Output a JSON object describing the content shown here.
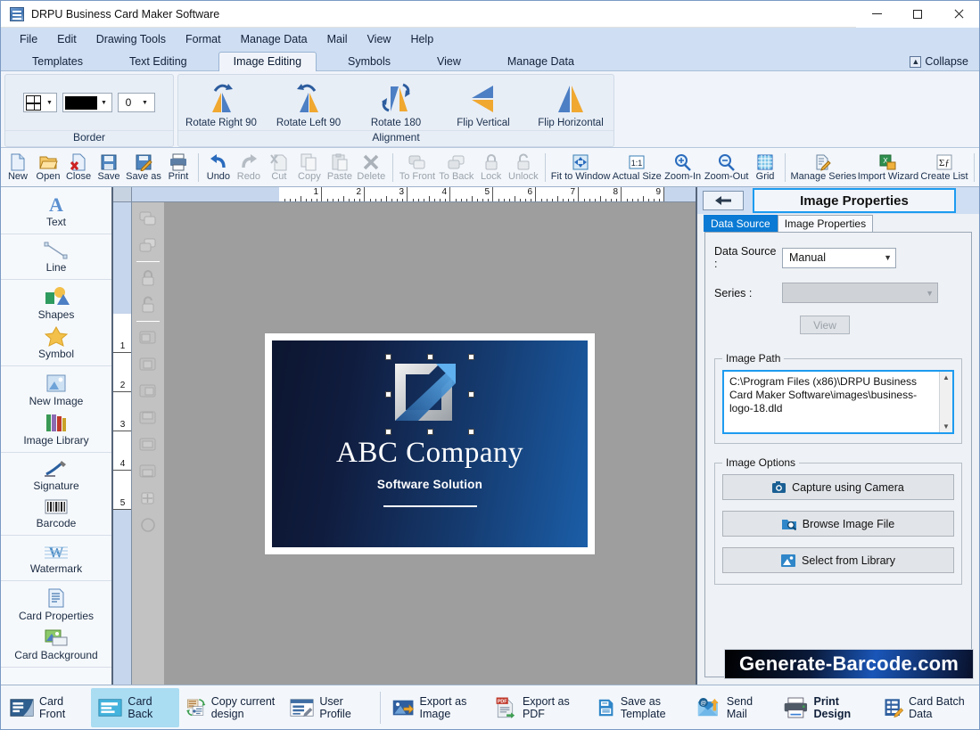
{
  "window": {
    "title": "DRPU Business Card Maker Software",
    "icon": "app-icon",
    "minimize": "minimize",
    "maximize": "maximize",
    "close": "close"
  },
  "menubar": {
    "items": [
      "File",
      "Edit",
      "Drawing Tools",
      "Format",
      "Manage Data",
      "Mail",
      "View",
      "Help"
    ]
  },
  "ribbon_tabs": {
    "items": [
      "Templates",
      "Text Editing",
      "Image Editing",
      "Symbols",
      "View",
      "Manage Data"
    ],
    "active": "Image Editing",
    "collapse_label": "Collapse"
  },
  "ribbon": {
    "groups": [
      {
        "label": "Border",
        "border_style_value": "",
        "border_color": "#000000",
        "border_width_value": "0"
      },
      {
        "label": "Alignment",
        "tools": [
          {
            "label": "Rotate Right 90",
            "icon": "rotate-right-90-icon"
          },
          {
            "label": "Rotate Left 90",
            "icon": "rotate-left-90-icon"
          },
          {
            "label": "Rotate 180",
            "icon": "rotate-180-icon"
          },
          {
            "label": "Flip Vertical",
            "icon": "flip-vertical-icon"
          },
          {
            "label": "Flip Horizontal",
            "icon": "flip-horizontal-icon"
          }
        ]
      }
    ]
  },
  "toolbar": {
    "groups": [
      [
        {
          "label": "New",
          "icon": "new-file-icon",
          "disabled": false
        },
        {
          "label": "Open",
          "icon": "open-folder-icon",
          "disabled": false
        },
        {
          "label": "Close",
          "icon": "close-file-icon",
          "disabled": false
        },
        {
          "label": "Save",
          "icon": "save-icon",
          "disabled": false
        },
        {
          "label": "Save as",
          "icon": "save-as-icon",
          "disabled": false
        },
        {
          "label": "Print",
          "icon": "print-icon",
          "disabled": false
        }
      ],
      [
        {
          "label": "Undo",
          "icon": "undo-icon",
          "disabled": false
        },
        {
          "label": "Redo",
          "icon": "redo-icon",
          "disabled": true
        },
        {
          "label": "Cut",
          "icon": "cut-icon",
          "disabled": true
        },
        {
          "label": "Copy",
          "icon": "copy-icon",
          "disabled": true
        },
        {
          "label": "Paste",
          "icon": "paste-icon",
          "disabled": true
        },
        {
          "label": "Delete",
          "icon": "delete-icon",
          "disabled": true
        }
      ],
      [
        {
          "label": "To Front",
          "icon": "to-front-icon",
          "disabled": true
        },
        {
          "label": "To Back",
          "icon": "to-back-icon",
          "disabled": true
        },
        {
          "label": "Lock",
          "icon": "lock-icon",
          "disabled": true
        },
        {
          "label": "Unlock",
          "icon": "unlock-icon",
          "disabled": true
        }
      ],
      [
        {
          "label": "Fit to Window",
          "icon": "fit-to-window-icon",
          "disabled": false
        },
        {
          "label": "Actual Size",
          "icon": "actual-size-icon",
          "disabled": false
        },
        {
          "label": "Zoom-In",
          "icon": "zoom-in-icon",
          "disabled": false
        },
        {
          "label": "Zoom-Out",
          "icon": "zoom-out-icon",
          "disabled": false
        },
        {
          "label": "Grid",
          "icon": "grid-icon",
          "disabled": false
        }
      ],
      [
        {
          "label": "Manage Series",
          "icon": "manage-series-icon",
          "disabled": false
        },
        {
          "label": "Import Wizard",
          "icon": "import-wizard-icon",
          "disabled": false
        },
        {
          "label": "Create List",
          "icon": "create-list-icon",
          "disabled": false
        }
      ]
    ]
  },
  "sidebar": {
    "sections": [
      {
        "items": [
          {
            "label": "Text",
            "icon": "text-a-icon"
          }
        ]
      },
      {
        "items": [
          {
            "label": "Line",
            "icon": "line-icon"
          }
        ]
      },
      {
        "items": [
          {
            "label": "Shapes",
            "icon": "shapes-icon"
          },
          {
            "label": "Symbol",
            "icon": "symbol-star-icon"
          }
        ]
      },
      {
        "items": [
          {
            "label": "New Image",
            "icon": "new-image-icon"
          },
          {
            "label": "Image Library",
            "icon": "image-library-icon"
          }
        ]
      },
      {
        "items": [
          {
            "label": "Signature",
            "icon": "signature-pen-icon"
          },
          {
            "label": "Barcode",
            "icon": "barcode-icon"
          }
        ]
      },
      {
        "items": [
          {
            "label": "Watermark",
            "icon": "watermark-w-icon"
          }
        ]
      },
      {
        "items": [
          {
            "label": "Card Properties",
            "icon": "card-properties-icon"
          },
          {
            "label": "Card Background",
            "icon": "card-background-icon"
          }
        ]
      }
    ]
  },
  "rulers": {
    "horizontal_ticks": [
      "1",
      "2",
      "3",
      "4",
      "5",
      "6",
      "7",
      "8",
      "9"
    ],
    "vertical_ticks": [
      "1",
      "2",
      "3",
      "4",
      "5"
    ]
  },
  "vertical_toolbar": {
    "items": [
      {
        "icon": "bring-to-front-icon"
      },
      {
        "icon": "send-to-back-icon"
      },
      {
        "icon": "lock-icon"
      },
      {
        "icon": "unlock-icon"
      },
      {
        "icon": "align-left-icon"
      },
      {
        "icon": "align-center-icon"
      },
      {
        "icon": "align-right-icon"
      },
      {
        "icon": "align-top-icon"
      },
      {
        "icon": "align-middle-icon"
      },
      {
        "icon": "align-bottom-icon"
      },
      {
        "icon": "distribute-icon"
      },
      {
        "icon": "rotate-shape-icon"
      }
    ]
  },
  "card": {
    "company_name": "ABC Company",
    "tagline": "Software Solution",
    "selected_object": "logo-image"
  },
  "properties_panel": {
    "back_button": "back-arrow-icon",
    "title": "Image Properties",
    "tabs": [
      {
        "label": "Data Source",
        "active": true
      },
      {
        "label": "Image Properties",
        "active": false
      }
    ],
    "data_source_label": "Data Source :",
    "data_source_value": "Manual",
    "series_label": "Series :",
    "series_value": "",
    "view_button": "View",
    "image_path_legend": "Image Path",
    "image_path_value": "C:\\Program Files (x86)\\DRPU Business Card Maker Software\\images\\business-logo-18.dld",
    "image_options_legend": "Image Options",
    "options": [
      {
        "label": "Capture using Camera",
        "icon": "camera-icon"
      },
      {
        "label": "Browse Image File",
        "icon": "browse-folder-icon"
      },
      {
        "label": "Select from Library",
        "icon": "picture-icon"
      }
    ],
    "accent_color": "#1d9bf0"
  },
  "watermark": {
    "text": "Generate-Barcode.com"
  },
  "bottombar": {
    "items": [
      {
        "label": "Card Front",
        "icon": "card-front-icon",
        "active": false,
        "bold": false
      },
      {
        "label": "Card Back",
        "icon": "card-back-icon",
        "active": true,
        "bold": false
      },
      {
        "label": "Copy current design",
        "icon": "copy-design-icon",
        "active": false,
        "bold": false
      },
      {
        "label": "User Profile",
        "icon": "user-profile-icon",
        "active": false,
        "bold": false
      },
      {
        "label": "Export as Image",
        "icon": "export-image-icon",
        "active": false,
        "bold": false
      },
      {
        "label": "Export as PDF",
        "icon": "export-pdf-icon",
        "active": false,
        "bold": false
      },
      {
        "label": "Save as Template",
        "icon": "save-template-icon",
        "active": false,
        "bold": false
      },
      {
        "label": "Send Mail",
        "icon": "send-mail-icon",
        "active": false,
        "bold": false
      },
      {
        "label": "Print Design",
        "icon": "print-design-icon",
        "active": false,
        "bold": true
      },
      {
        "label": "Card Batch Data",
        "icon": "card-batch-data-icon",
        "active": false,
        "bold": false
      }
    ]
  }
}
